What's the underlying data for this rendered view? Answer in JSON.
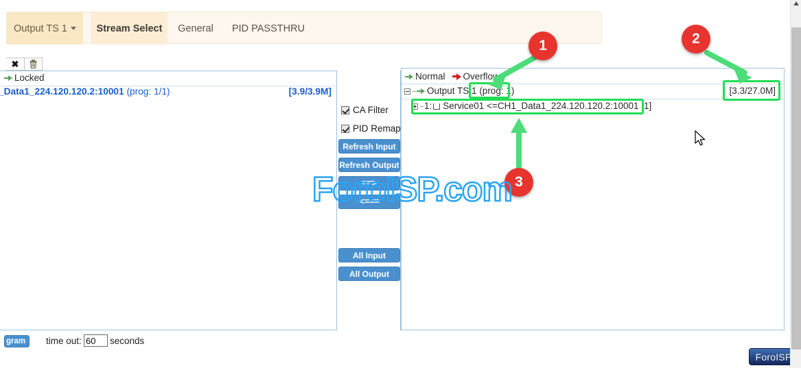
{
  "tabs": [
    {
      "label": "Output TS 1",
      "type": "dropdown",
      "icon": "caret-down-icon"
    },
    {
      "label": "Stream Select",
      "type": "active"
    },
    {
      "label": "General",
      "type": "plain"
    },
    {
      "label": "PID PASSTHRU",
      "type": "plain"
    }
  ],
  "left_panel": {
    "toolbar": [
      {
        "icon": "close-x-icon",
        "glyph": "✖"
      },
      {
        "icon": "trash-icon",
        "glyph": "🗑"
      }
    ],
    "locked_label": "Locked",
    "streams": [
      {
        "name": "_Data1_224.120.120.2:10001",
        "prog": "(prog: 1/1)",
        "bitrate": "[3.9/3.9M]"
      }
    ]
  },
  "center_panel": {
    "checkboxes": [
      {
        "label": "CA Filter",
        "checked": true
      },
      {
        "label": "PID Remap",
        "checked": true
      }
    ],
    "buttons": [
      {
        "label": "Refresh Input",
        "name": "refresh-input-button"
      },
      {
        "label": "Refresh Output",
        "name": "refresh-output-button"
      },
      {
        "label": "==>",
        "name": "move-right-button"
      },
      {
        "label": "<===",
        "name": "move-left-button"
      },
      {
        "label": "All Input",
        "name": "all-input-button"
      },
      {
        "label": "All Output",
        "name": "all-output-button"
      }
    ]
  },
  "right_panel": {
    "legend": {
      "normal": "Normal",
      "overflow": "Overflow",
      "normal_icon": "green-arrow-icon",
      "overflow_icon": "red-arrow-icon"
    },
    "output": {
      "name": "Output TS 1",
      "prog": "(prog: 1)",
      "bitrate": "[3.3/27.0M]",
      "expander": "minus"
    },
    "services": [
      {
        "text": "1: ⊔ Service01 <=CH1_Data1_224.120.120.2:10001 [1]",
        "index": "1:",
        "name": "Service01",
        "source": "<=CH1_Data1_224.120.120.2:10001",
        "pid": "[1]",
        "expander": "plus",
        "checked": false
      }
    ]
  },
  "bottom_bar": {
    "program_button": "gram",
    "timeout_label": "time out:",
    "timeout_value": "60",
    "seconds_label": "seconds"
  },
  "watermark": "ForoISP.com",
  "badge": "ForoISP",
  "callouts": [
    {
      "number": "1"
    },
    {
      "number": "2"
    },
    {
      "number": "3"
    }
  ],
  "colors": {
    "accent_blue": "#4a90cf",
    "tab_active": "#fbeed5",
    "tab_dropdown": "#fae7c6",
    "highlight_green": "#22dd55",
    "callout_red": "#e8342f",
    "link_blue": "#1a5ec9"
  }
}
